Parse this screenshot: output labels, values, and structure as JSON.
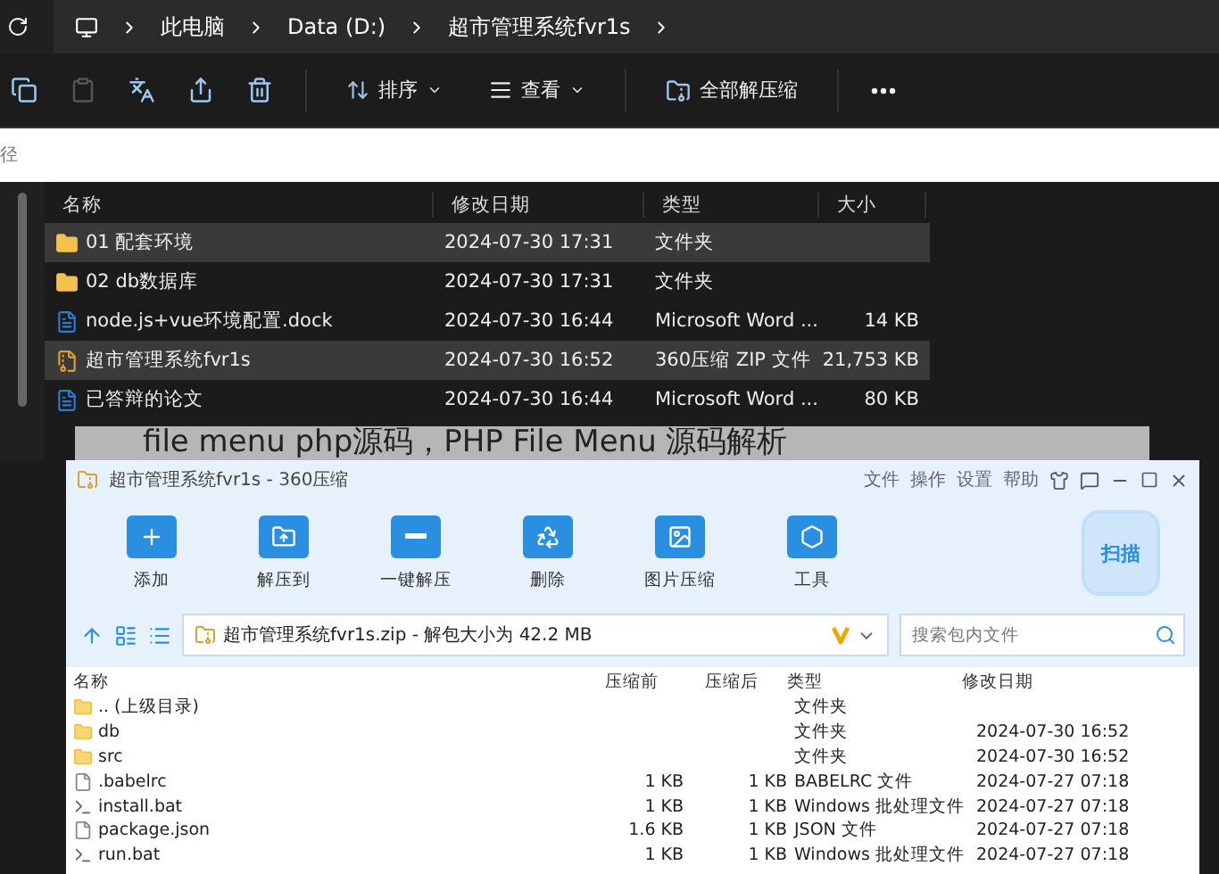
{
  "explorer": {
    "breadcrumb": [
      "此电脑",
      "Data (D:)",
      "超市管理系统fvr1s"
    ],
    "icon_buttons": [
      {
        "disabled": false
      },
      {
        "disabled": true
      },
      {
        "disabled": false
      },
      {
        "disabled": false
      },
      {
        "disabled": false
      }
    ],
    "sort_label": "排序",
    "view_label": "查看",
    "extract_label": "全部解压缩",
    "path_placeholder": "径",
    "columns": [
      "名称",
      "修改日期",
      "类型",
      "大小"
    ],
    "rows": [
      {
        "kind": "folder",
        "name": "01 配套环境",
        "date": "2024-07-30 17:31",
        "type": "文件夹",
        "size": "",
        "selected": true
      },
      {
        "kind": "folder",
        "name": "02 db数据库",
        "date": "2024-07-30 17:31",
        "type": "文件夹",
        "size": "",
        "selected": false
      },
      {
        "kind": "word",
        "name": "node.js+vue环境配置.dock",
        "date": "2024-07-30 16:44",
        "type": "Microsoft Word ...",
        "size": "14 KB",
        "selected": false
      },
      {
        "kind": "zip",
        "name": "超市管理系统fvr1s",
        "date": "2024-07-30 16:52",
        "type": "360压缩 ZIP 文件",
        "size": "21,753 KB",
        "selected": true
      },
      {
        "kind": "word",
        "name": "已答辩的论文",
        "date": "2024-07-30 16:44",
        "type": "Microsoft Word ...",
        "size": "80 KB",
        "selected": false
      }
    ]
  },
  "caption": "file menu php源码，PHP File Menu 源码解析",
  "archiver": {
    "title": "超市管理系统fvr1s - 360压缩",
    "menu": [
      "文件",
      "操作",
      "设置",
      "帮助"
    ],
    "tools": [
      "添加",
      "解压到",
      "一键解压",
      "删除",
      "图片压缩",
      "工具"
    ],
    "scan": "扫描",
    "address": "超市管理系统fvr1s.zip - 解包大小为 42.2 MB",
    "search_placeholder": "搜索包内文件",
    "columns": [
      "名称",
      "压缩前",
      "压缩后",
      "类型",
      "修改日期"
    ],
    "rows": [
      {
        "kind": "parent",
        "name": ".. (上级目录)",
        "before": "",
        "after": "",
        "type": "文件夹",
        "date": ""
      },
      {
        "kind": "folder",
        "name": "db",
        "before": "",
        "after": "",
        "type": "文件夹",
        "date": "2024-07-30 16:52"
      },
      {
        "kind": "folder",
        "name": "src",
        "before": "",
        "after": "",
        "type": "文件夹",
        "date": "2024-07-30 16:52"
      },
      {
        "kind": "file",
        "name": ".babelrc",
        "before": "1 KB",
        "after": "1 KB",
        "type": "BABELRC 文件",
        "date": "2024-07-27 07:18"
      },
      {
        "kind": "bat",
        "name": "install.bat",
        "before": "1 KB",
        "after": "1 KB",
        "type": "Windows 批处理文件",
        "date": "2024-07-27 07:18"
      },
      {
        "kind": "file",
        "name": "package.json",
        "before": "1.6 KB",
        "after": "1 KB",
        "type": "JSON 文件",
        "date": "2024-07-27 07:18"
      },
      {
        "kind": "bat",
        "name": "run.bat",
        "before": "1 KB",
        "after": "1 KB",
        "type": "Windows 批处理文件",
        "date": "2024-07-27 07:18"
      }
    ]
  }
}
